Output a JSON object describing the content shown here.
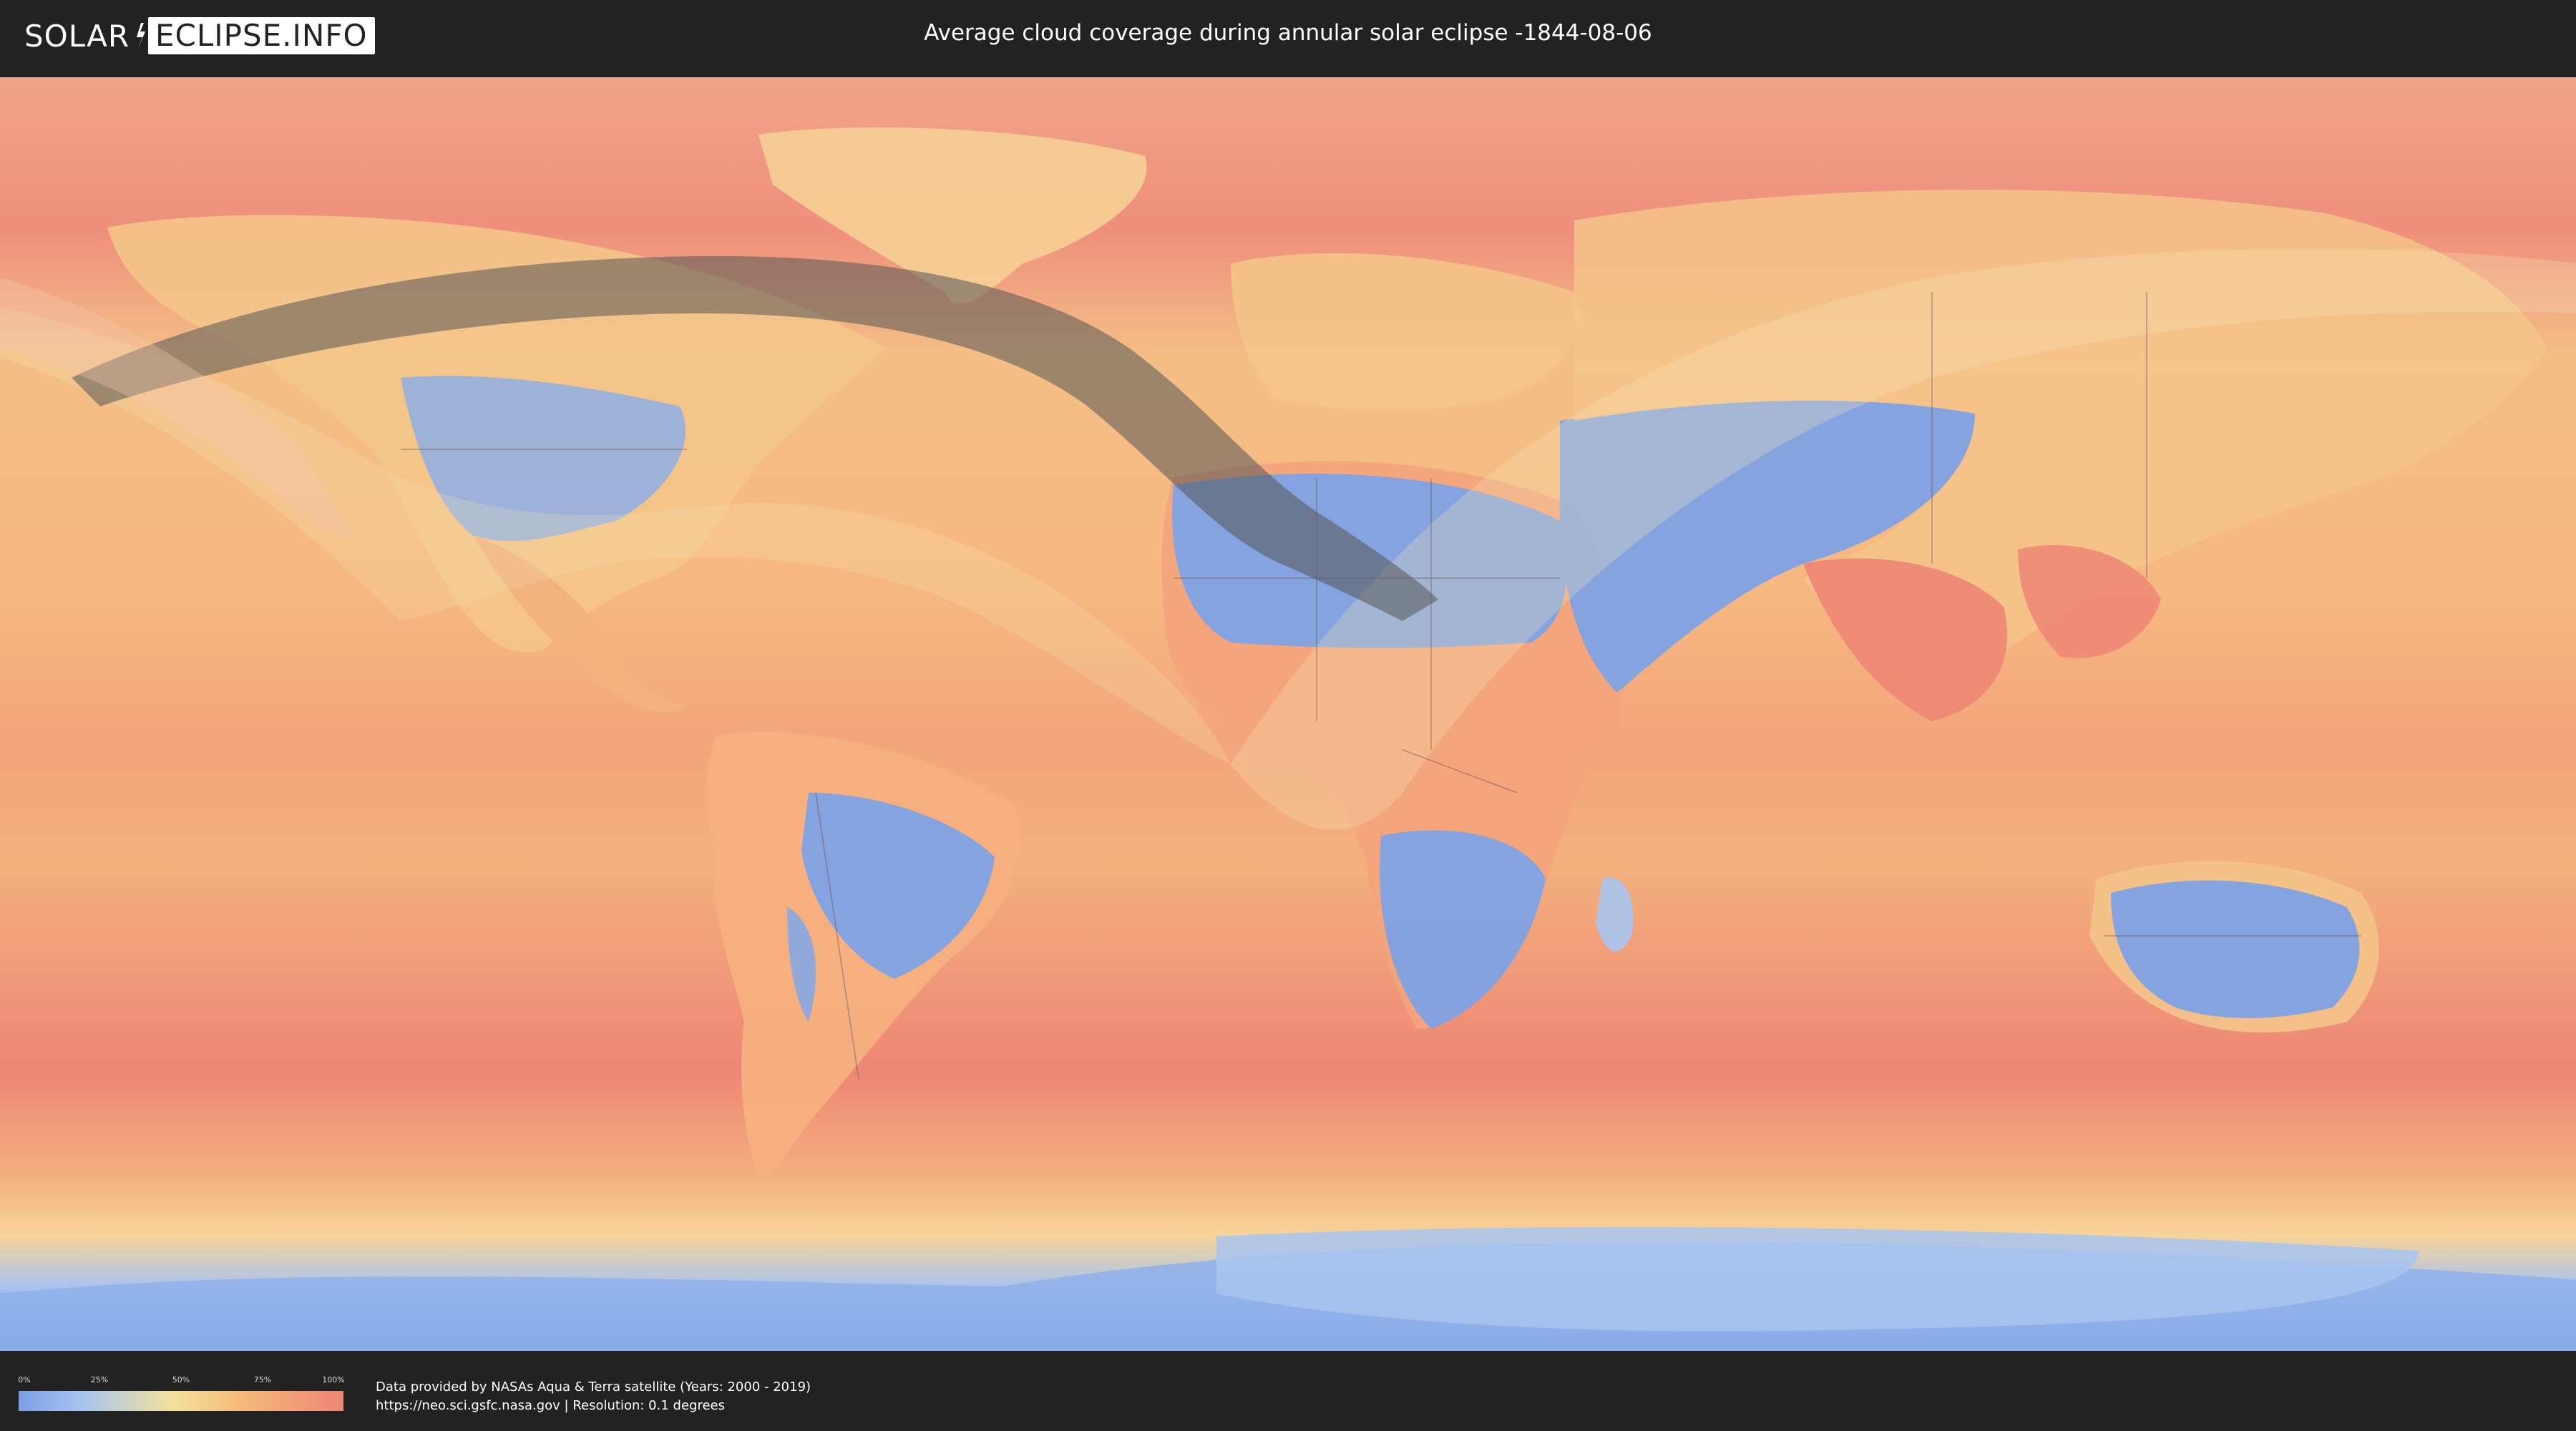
{
  "header": {
    "logo_left": "SOLAR",
    "logo_right": "ECLIPSE.INFO",
    "title": "Average cloud coverage during annular solar eclipse -1844-08-06"
  },
  "legend": {
    "ticks": [
      "0%",
      "25%",
      "50%",
      "75%",
      "100%"
    ],
    "colors": [
      "#7c9fe6",
      "#a8c4ef",
      "#f4e29a",
      "#f5b777",
      "#ee8676"
    ]
  },
  "credits": {
    "line1": "Data provided by NASAs Aqua & Terra satellite (Years: 2000 - 2019)",
    "line2": "https://neo.sci.gsfc.nasa.gov | Resolution: 0.1 degrees"
  },
  "map": {
    "colors": {
      "ocean": "#f2a77a",
      "cloudy": "#ee8676",
      "clear": "#7ea2e4",
      "mid": "#f5d596",
      "shadow": "#555555",
      "penumbra": "#f6e6b8"
    }
  }
}
